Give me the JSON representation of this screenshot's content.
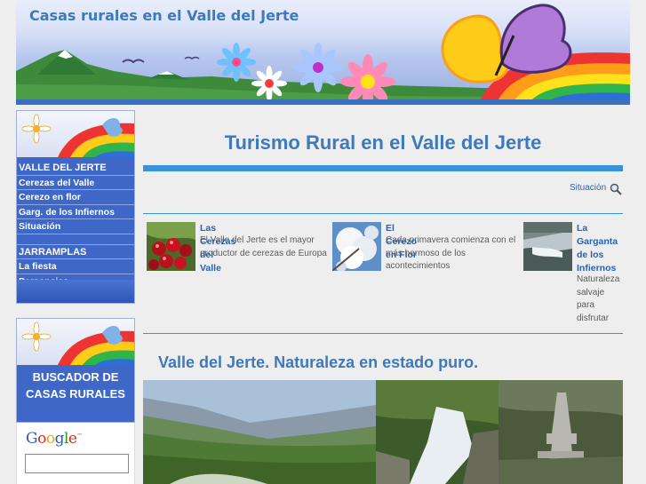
{
  "header": {
    "title": "Casas rurales en el Valle del Jerte"
  },
  "sidebar": {
    "nav_items": [
      {
        "label": "VALLE DEL JERTE",
        "section": true
      },
      {
        "label": "Cerezas del Valle"
      },
      {
        "label": "Cerezo en flor"
      },
      {
        "label": "Garg. de los Infiernos"
      },
      {
        "label": "Situación"
      },
      {
        "label": "JARRAMPLAS",
        "section": true
      },
      {
        "label": "La fiesta"
      },
      {
        "label": "Personajes"
      }
    ],
    "search_label_1": "BUSCADOR DE",
    "search_label_2": "CASAS RURALES"
  },
  "google": {
    "logo": "Google",
    "tm": "™"
  },
  "main": {
    "title": "Turismo Rural en el Valle del Jerte",
    "situacion_link": "Situación",
    "subtitle": "Valle del Jerte. Naturaleza en estado puro."
  },
  "features": [
    {
      "title": "Las Cerezas del Valle",
      "text_lines": [
        "El Valle del Jerte es el mayor",
        "productor de cerezas de Europa"
      ]
    },
    {
      "title": "El Cerezo en Flor",
      "text_lines": [
        "Cada primavera comienza con el",
        "más hermoso de los",
        "acontecimientos"
      ]
    },
    {
      "title_lines": [
        "La",
        "Garganta",
        "de los",
        "Infiernos"
      ],
      "text_lines": [
        "Naturaleza",
        "salvaje",
        "para",
        "disfrutar"
      ]
    }
  ],
  "colors": {
    "accent": "#3d79bb",
    "nav_bg": "#3e67c7",
    "rule": "#3a93d8",
    "link": "#2a61b0"
  }
}
